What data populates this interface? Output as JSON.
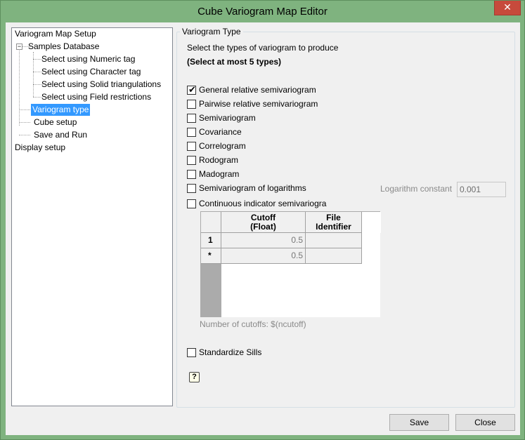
{
  "window": {
    "title": "Cube Variogram Map Editor",
    "close_glyph": "✕"
  },
  "tree": {
    "root": "Variogram Map Setup",
    "samples_database": "Samples Database",
    "sub_items": [
      "Select using Numeric tag",
      "Select using Character tag",
      "Select using Solid triangulations",
      "Select using Field restrictions"
    ],
    "variogram_type": "Variogram type",
    "cube_setup": "Cube setup",
    "save_and_run": "Save and Run",
    "display_setup": "Display setup",
    "selected": "Variogram type",
    "expander_glyph": "−"
  },
  "panel": {
    "group_title": "Variogram Type",
    "instruction": "Select the types of variogram to produce",
    "limit_note": "(Select at most 5 types)",
    "options": [
      {
        "label": "General relative semivariogram",
        "checked": true
      },
      {
        "label": "Pairwise relative semivariogram",
        "checked": false
      },
      {
        "label": "Semivariogram",
        "checked": false
      },
      {
        "label": "Covariance",
        "checked": false
      },
      {
        "label": "Correlogram",
        "checked": false
      },
      {
        "label": "Rodogram",
        "checked": false
      },
      {
        "label": "Madogram",
        "checked": false
      },
      {
        "label": "Semivariogram of logarithms",
        "checked": false
      },
      {
        "label": "Continuous indicator semivariogra",
        "checked": false
      }
    ],
    "log_constant": {
      "label": "Logarithm constant",
      "value": "0.001"
    },
    "cutoff_table": {
      "headers": [
        "Cutoff\n(Float)",
        "File\nIdentifier"
      ],
      "header_line1": [
        "Cutoff",
        "File"
      ],
      "header_line2": [
        "(Float)",
        "Identifier"
      ],
      "rows": [
        {
          "row_label": "1",
          "cutoff": "0.5",
          "file": ""
        },
        {
          "row_label": "*",
          "cutoff": "0.5",
          "file": ""
        }
      ]
    },
    "ncutoff_note": "Number of cutoffs: $(ncutoff)",
    "standardize_sills": {
      "label": "Standardize Sills",
      "checked": false
    },
    "help_glyph": "?"
  },
  "buttons": {
    "save": "Save",
    "close": "Close"
  },
  "check_glyph": "✔"
}
